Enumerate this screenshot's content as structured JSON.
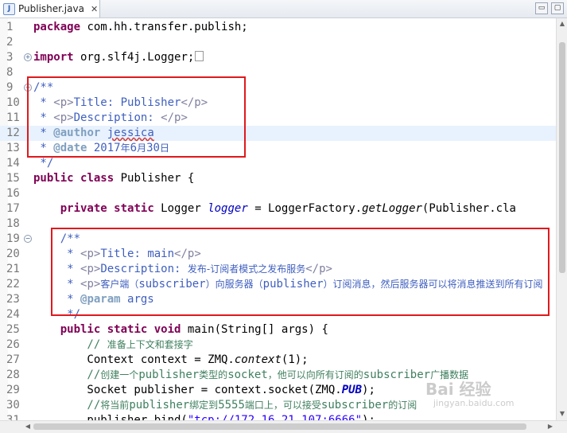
{
  "tab": {
    "title": "Publisher.java",
    "close_symbol": "✕",
    "icon_glyph": "J"
  },
  "window_buttons": [
    "▭",
    "▢"
  ],
  "lines": [
    {
      "n": "1",
      "fold": "",
      "current": false,
      "segs": [
        {
          "t": "package",
          "c": "kw"
        },
        {
          "t": " com.hh.transfer.publish;",
          "c": ""
        }
      ]
    },
    {
      "n": "2",
      "fold": "",
      "current": false,
      "segs": []
    },
    {
      "n": "3",
      "fold": "+",
      "current": false,
      "segs": [
        {
          "t": "import",
          "c": "kw"
        },
        {
          "t": " org.slf4j.Logger;",
          "c": ""
        },
        {
          "t": "",
          "c": "box"
        }
      ]
    },
    {
      "n": "8",
      "fold": "",
      "current": false,
      "segs": []
    },
    {
      "n": "9",
      "fold": "−",
      "current": false,
      "segs": [
        {
          "t": "/**",
          "c": "jd"
        }
      ]
    },
    {
      "n": "10",
      "fold": "",
      "current": false,
      "segs": [
        {
          "t": " * ",
          "c": "jd"
        },
        {
          "t": "<p>",
          "c": "jd-html"
        },
        {
          "t": "Title: Publisher",
          "c": "jd"
        },
        {
          "t": "</p>",
          "c": "jd-html"
        }
      ]
    },
    {
      "n": "11",
      "fold": "",
      "current": false,
      "segs": [
        {
          "t": " * ",
          "c": "jd"
        },
        {
          "t": "<p>",
          "c": "jd-html"
        },
        {
          "t": "Description: ",
          "c": "jd"
        },
        {
          "t": "</p>",
          "c": "jd-html"
        }
      ]
    },
    {
      "n": "12",
      "fold": "",
      "current": true,
      "segs": [
        {
          "t": " * ",
          "c": "jd"
        },
        {
          "t": "@author",
          "c": "jd-tag"
        },
        {
          "t": " ",
          "c": "jd"
        },
        {
          "t": "jessica",
          "c": "jd squiggle"
        }
      ]
    },
    {
      "n": "13",
      "fold": "",
      "current": false,
      "segs": [
        {
          "t": " * ",
          "c": "jd"
        },
        {
          "t": "@date",
          "c": "jd-tag"
        },
        {
          "t": " 2017",
          "c": "jd"
        },
        {
          "t": "年",
          "c": "jd cjk"
        },
        {
          "t": "6",
          "c": "jd"
        },
        {
          "t": "月",
          "c": "jd cjk"
        },
        {
          "t": "30",
          "c": "jd"
        },
        {
          "t": "日",
          "c": "jd cjk"
        }
      ]
    },
    {
      "n": "14",
      "fold": "",
      "current": false,
      "segs": [
        {
          "t": " */",
          "c": "jd"
        }
      ]
    },
    {
      "n": "15",
      "fold": "",
      "current": false,
      "segs": [
        {
          "t": "public",
          "c": "kw"
        },
        {
          "t": " ",
          "c": ""
        },
        {
          "t": "class",
          "c": "kw"
        },
        {
          "t": " Publisher {",
          "c": ""
        }
      ]
    },
    {
      "n": "16",
      "fold": "",
      "current": false,
      "segs": []
    },
    {
      "n": "17",
      "fold": "",
      "current": false,
      "segs": [
        {
          "t": "    ",
          "c": ""
        },
        {
          "t": "private",
          "c": "kw"
        },
        {
          "t": " ",
          "c": ""
        },
        {
          "t": "static",
          "c": "kw"
        },
        {
          "t": " Logger ",
          "c": ""
        },
        {
          "t": "logger",
          "c": "fld"
        },
        {
          "t": " = LoggerFactory.",
          "c": ""
        },
        {
          "t": "getLogger",
          "c": "stat"
        },
        {
          "t": "(Publisher.cla",
          "c": ""
        }
      ]
    },
    {
      "n": "18",
      "fold": "",
      "current": false,
      "segs": []
    },
    {
      "n": "19",
      "fold": "−",
      "current": false,
      "segs": [
        {
          "t": "    /**",
          "c": "jd"
        }
      ]
    },
    {
      "n": "20",
      "fold": "",
      "current": false,
      "segs": [
        {
          "t": "     * ",
          "c": "jd"
        },
        {
          "t": "<p>",
          "c": "jd-html"
        },
        {
          "t": "Title: main",
          "c": "jd"
        },
        {
          "t": "</p>",
          "c": "jd-html"
        }
      ]
    },
    {
      "n": "21",
      "fold": "",
      "current": false,
      "segs": [
        {
          "t": "     * ",
          "c": "jd"
        },
        {
          "t": "<p>",
          "c": "jd-html"
        },
        {
          "t": "Description: ",
          "c": "jd"
        },
        {
          "t": "发布-订阅者模式之发布服务",
          "c": "jd cjk"
        },
        {
          "t": "</p>",
          "c": "jd-html"
        }
      ]
    },
    {
      "n": "22",
      "fold": "",
      "current": false,
      "segs": [
        {
          "t": "     * ",
          "c": "jd"
        },
        {
          "t": "<p>",
          "c": "jd-html"
        },
        {
          "t": "客户端（",
          "c": "jd cjk"
        },
        {
          "t": "subscriber",
          "c": "jd"
        },
        {
          "t": "）向服务器（",
          "c": "jd cjk"
        },
        {
          "t": "publisher",
          "c": "jd"
        },
        {
          "t": "）订阅消息，然后服务器可以将消息推送到所有订阅",
          "c": "jd cjk"
        }
      ]
    },
    {
      "n": "23",
      "fold": "",
      "current": false,
      "segs": [
        {
          "t": "     * ",
          "c": "jd"
        },
        {
          "t": "@param",
          "c": "jd-tag"
        },
        {
          "t": " args",
          "c": "jd"
        }
      ]
    },
    {
      "n": "24",
      "fold": "",
      "current": false,
      "segs": [
        {
          "t": "     */",
          "c": "jd"
        }
      ]
    },
    {
      "n": "25",
      "fold": "",
      "current": false,
      "segs": [
        {
          "t": "    ",
          "c": ""
        },
        {
          "t": "public",
          "c": "kw"
        },
        {
          "t": " ",
          "c": ""
        },
        {
          "t": "static",
          "c": "kw"
        },
        {
          "t": " ",
          "c": ""
        },
        {
          "t": "void",
          "c": "kw"
        },
        {
          "t": " main(String[] args) {",
          "c": ""
        }
      ]
    },
    {
      "n": "26",
      "fold": "",
      "current": false,
      "segs": [
        {
          "t": "        // ",
          "c": "cm"
        },
        {
          "t": "准备上下文和套接字",
          "c": "cm cjk"
        }
      ]
    },
    {
      "n": "27",
      "fold": "",
      "current": false,
      "segs": [
        {
          "t": "        Context context = ZMQ.",
          "c": ""
        },
        {
          "t": "context",
          "c": "stat"
        },
        {
          "t": "(1);",
          "c": ""
        }
      ]
    },
    {
      "n": "28",
      "fold": "",
      "current": false,
      "segs": [
        {
          "t": "        //",
          "c": "cm"
        },
        {
          "t": "创建一个",
          "c": "cm cjk"
        },
        {
          "t": "publisher",
          "c": "cm"
        },
        {
          "t": "类型的",
          "c": "cm cjk"
        },
        {
          "t": "socket",
          "c": "cm"
        },
        {
          "t": "，他可以向所有订阅的",
          "c": "cm cjk"
        },
        {
          "t": "subscriber",
          "c": "cm"
        },
        {
          "t": "广播数据",
          "c": "cm cjk"
        }
      ]
    },
    {
      "n": "29",
      "fold": "",
      "current": false,
      "segs": [
        {
          "t": "        Socket publisher = context.socket(ZMQ.",
          "c": ""
        },
        {
          "t": "PUB",
          "c": "sfld"
        },
        {
          "t": ");",
          "c": ""
        }
      ]
    },
    {
      "n": "30",
      "fold": "",
      "current": false,
      "segs": [
        {
          "t": "        //",
          "c": "cm"
        },
        {
          "t": "将当前",
          "c": "cm cjk"
        },
        {
          "t": "publisher",
          "c": "cm"
        },
        {
          "t": "绑定到",
          "c": "cm cjk"
        },
        {
          "t": "5555",
          "c": "cm"
        },
        {
          "t": "端口上，可以接受",
          "c": "cm cjk"
        },
        {
          "t": "subscriber",
          "c": "cm"
        },
        {
          "t": "的订阅",
          "c": "cm cjk"
        }
      ]
    },
    {
      "n": "31",
      "fold": "",
      "current": false,
      "segs": [
        {
          "t": "        publisher.bind(",
          "c": ""
        },
        {
          "t": "\"tcp://172.16.21.107:6666\"",
          "c": "str"
        },
        {
          "t": ");",
          "c": ""
        }
      ]
    }
  ],
  "watermark": {
    "main": "Bai 经验",
    "sub": "jingyan.baidu.com"
  }
}
